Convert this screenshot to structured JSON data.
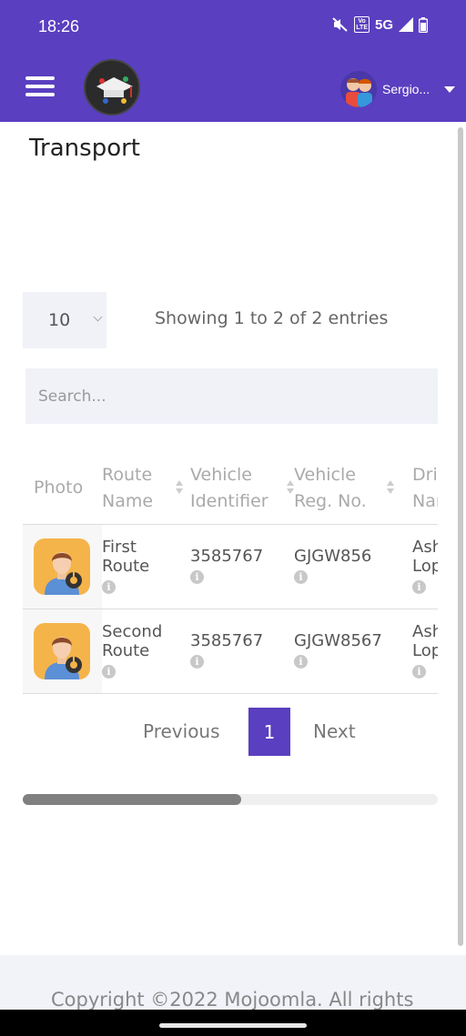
{
  "status_bar": {
    "time": "18:26",
    "network": "5G",
    "volte": "Vo LTE"
  },
  "app_bar": {
    "user_name": "Sergio..."
  },
  "page": {
    "title": "Transport"
  },
  "table_controls": {
    "page_length": "10",
    "info": "Showing 1 to 2 of 2 entries",
    "search_placeholder": "Search..."
  },
  "table": {
    "columns": [
      "Photo",
      "Route Name",
      "Vehicle Identifier",
      "Vehicle Reg. No.",
      "Driver Name"
    ],
    "rows": [
      {
        "route_name": "First Route",
        "vehicle_identifier": "3585767",
        "vehicle_reg_no": "GJGW856",
        "driver_name": "Ashley Lopez"
      },
      {
        "route_name": "Second Route",
        "vehicle_identifier": "3585767",
        "vehicle_reg_no": "GJGW8567",
        "driver_name": "Ashley Lopez"
      }
    ]
  },
  "pagination": {
    "previous": "Previous",
    "current_page": "1",
    "next": "Next"
  },
  "footer": {
    "copyright": "Copyright ©2022 Mojoomla. All rights"
  },
  "colors": {
    "brand": "#5a3fc0",
    "input_bg": "#f0f2f8"
  },
  "icons": {
    "menu": "hamburger-icon",
    "dropdown": "caret-down-icon",
    "driver_photo": "driver-avatar-icon",
    "info": "info-icon"
  }
}
